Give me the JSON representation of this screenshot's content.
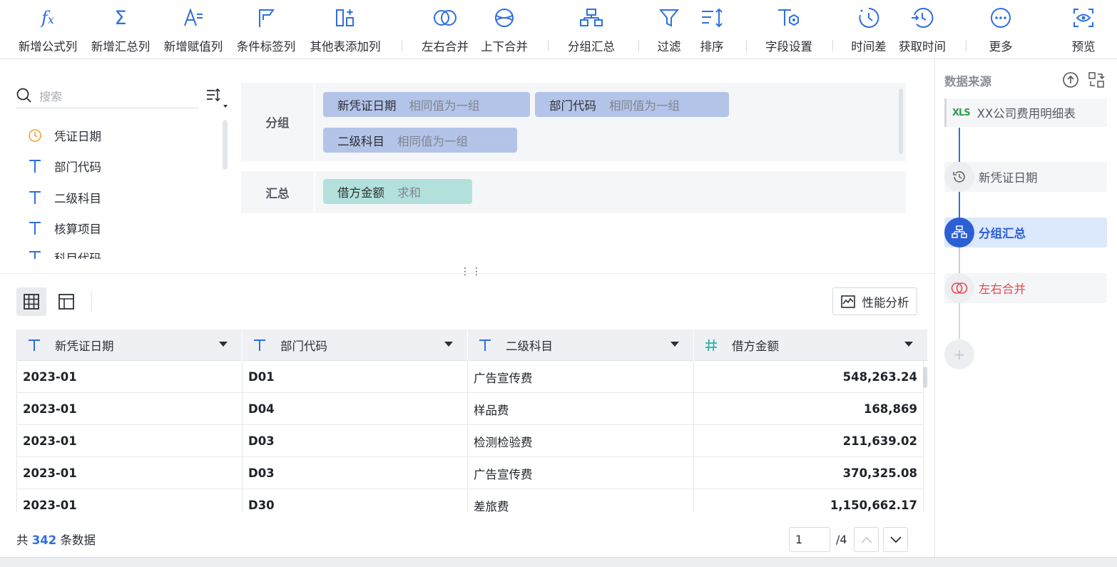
{
  "toolbar": {
    "items": [
      {
        "label": "新增公式列",
        "icon": "formula-icon"
      },
      {
        "label": "新增汇总列",
        "icon": "sigma-icon"
      },
      {
        "label": "新增赋值列",
        "icon": "assign-icon"
      },
      {
        "label": "条件标签列",
        "icon": "flag-icon"
      },
      {
        "label": "其他表添加列",
        "icon": "add-column-icon"
      },
      {
        "label": "左右合并",
        "icon": "merge-horizontal-icon"
      },
      {
        "label": "上下合并",
        "icon": "merge-vertical-icon"
      },
      {
        "label": "分组汇总",
        "icon": "group-icon"
      },
      {
        "label": "过滤",
        "icon": "filter-icon"
      },
      {
        "label": "排序",
        "icon": "sort-icon"
      },
      {
        "label": "字段设置",
        "icon": "field-settings-icon"
      },
      {
        "label": "时间差",
        "icon": "clock-icon"
      },
      {
        "label": "获取时间",
        "icon": "clock-arrow-icon"
      },
      {
        "label": "更多",
        "icon": "more-icon"
      },
      {
        "label": "预览",
        "icon": "preview-eye-icon"
      }
    ]
  },
  "fields": {
    "search_placeholder": "搜索",
    "items": [
      {
        "label": "凭证日期",
        "type": "time"
      },
      {
        "label": "部门代码",
        "type": "text"
      },
      {
        "label": "二级科目",
        "type": "text"
      },
      {
        "label": "核算项目",
        "type": "text"
      },
      {
        "label": "科目代码",
        "type": "text"
      }
    ]
  },
  "config": {
    "group_label": "分组",
    "group_chips": [
      {
        "name": "新凭证日期",
        "desc": "相同值为一组"
      },
      {
        "name": "部门代码",
        "desc": "相同值为一组"
      },
      {
        "name": "二级科目",
        "desc": "相同值为一组"
      }
    ],
    "summary_label": "汇总",
    "summary_chips": [
      {
        "name": "借方金额",
        "desc": "求和"
      }
    ]
  },
  "perf_button": "性能分析",
  "grid": {
    "columns": [
      {
        "label": "新凭证日期",
        "type": "text"
      },
      {
        "label": "部门代码",
        "type": "text"
      },
      {
        "label": "二级科目",
        "type": "text"
      },
      {
        "label": "借方金额",
        "type": "number"
      }
    ],
    "rows": [
      [
        "2023-01",
        "D01",
        "广告宣传费",
        "548,263.24"
      ],
      [
        "2023-01",
        "D04",
        "样品费",
        "168,869"
      ],
      [
        "2023-01",
        "D03",
        "检测检验费",
        "211,639.02"
      ],
      [
        "2023-01",
        "D03",
        "广告宣传费",
        "370,325.08"
      ],
      [
        "2023-01",
        "D30",
        "差旅费",
        "1,150,662.17"
      ]
    ]
  },
  "footer": {
    "prefix": "共",
    "count": "342",
    "suffix": "条数据",
    "page_value": "1",
    "page_total": "/4"
  },
  "flow": {
    "title": "数据来源",
    "source": {
      "badge": "XLS",
      "label": "XX公司费用明细表"
    },
    "steps": [
      {
        "label": "新凭证日期",
        "state": "normal"
      },
      {
        "label": "分组汇总",
        "state": "active"
      },
      {
        "label": "左右合并",
        "state": "error"
      }
    ],
    "add_label": "+"
  },
  "colors": {
    "accent": "#2f6fe0",
    "active_step": "#2c5fd4",
    "error": "#e04b4b",
    "group_chip": "#b4c4e8",
    "summary_chip": "#b2e1db"
  }
}
